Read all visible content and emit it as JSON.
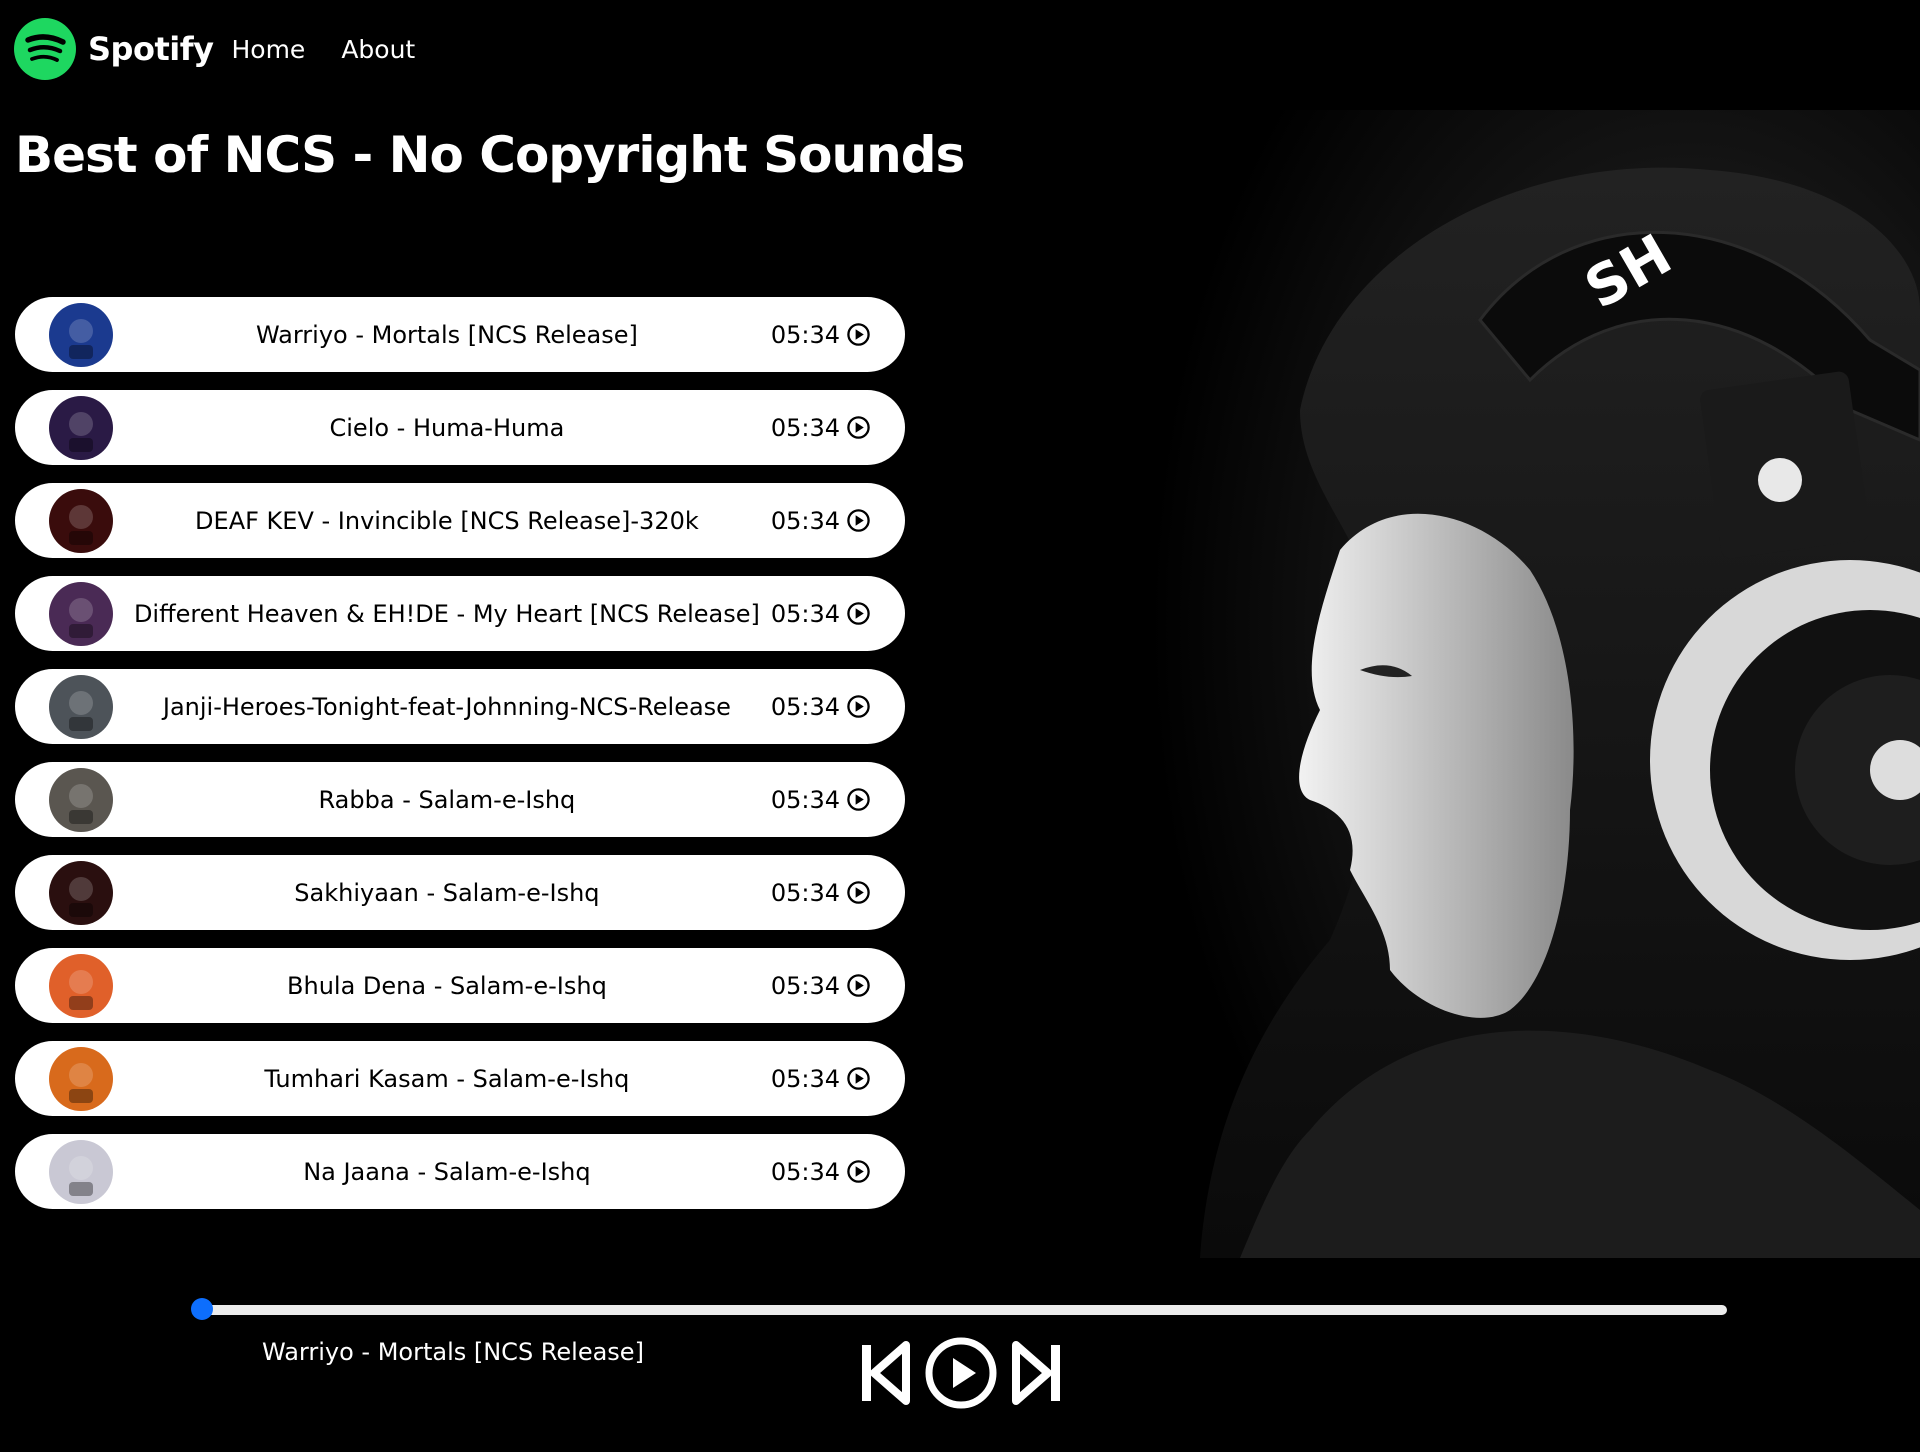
{
  "nav": {
    "brand": "Spotify",
    "links": [
      "Home",
      "About"
    ]
  },
  "page_title": "Best of NCS - No Copyright Sounds",
  "songs": [
    {
      "name": "Warriyo - Mortals [NCS Release]",
      "duration": "05:34",
      "cover": "#1b3a8f"
    },
    {
      "name": "Cielo - Huma-Huma",
      "duration": "05:34",
      "cover": "#2a1a45"
    },
    {
      "name": "DEAF KEV - Invincible [NCS Release]-320k",
      "duration": "05:34",
      "cover": "#3a0c0c"
    },
    {
      "name": "Different Heaven & EH!DE - My Heart [NCS Release]",
      "duration": "05:34",
      "cover": "#4a2a55"
    },
    {
      "name": "Janji-Heroes-Tonight-feat-Johnning-NCS-Release",
      "duration": "05:34",
      "cover": "#4d5359"
    },
    {
      "name": "Rabba - Salam-e-Ishq",
      "duration": "05:34",
      "cover": "#5a5650"
    },
    {
      "name": "Sakhiyaan - Salam-e-Ishq",
      "duration": "05:34",
      "cover": "#2a0f0f"
    },
    {
      "name": "Bhula Dena - Salam-e-Ishq",
      "duration": "05:34",
      "cover": "#e0602a"
    },
    {
      "name": "Tumhari Kasam - Salam-e-Ishq",
      "duration": "05:34",
      "cover": "#d86a1c"
    },
    {
      "name": "Na Jaana - Salam-e-Ishq",
      "duration": "05:34",
      "cover": "#c9c8d4"
    }
  ],
  "player": {
    "now_playing": "Warriyo - Mortals [NCS Release]",
    "progress": 0
  },
  "colors": {
    "brand": "#1ed760",
    "accent": "#0d6efd",
    "background": "#000000",
    "item_bg": "#ffffff"
  },
  "icons": {
    "logo": "spotify-logo-icon",
    "song_play": "play-circle-icon",
    "prev": "skip-previous-icon",
    "play": "play-circle-icon",
    "next": "skip-next-icon"
  }
}
